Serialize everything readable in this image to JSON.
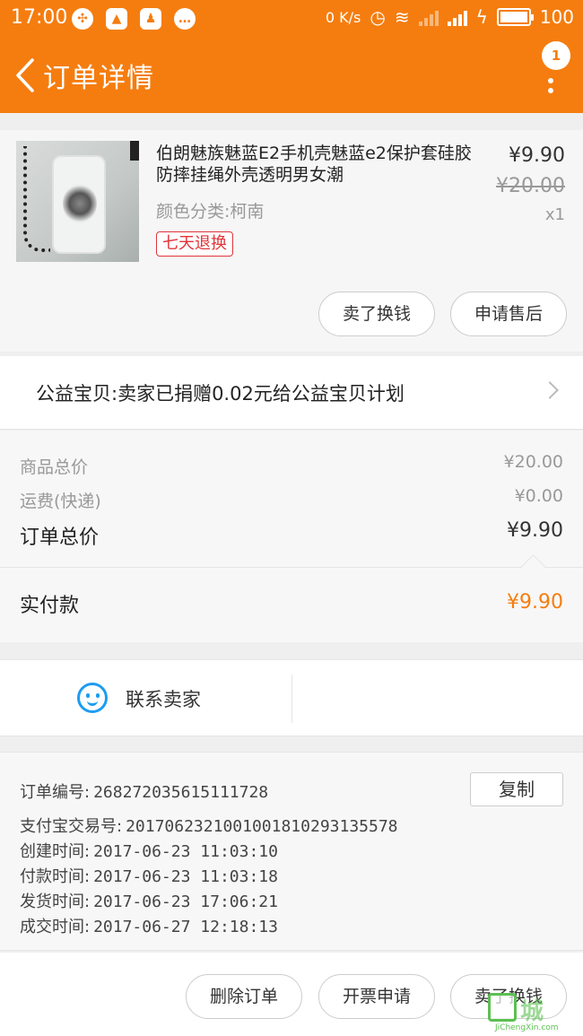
{
  "status_bar": {
    "time": "17:00",
    "net_speed": "0 K/s",
    "battery": "100"
  },
  "nav": {
    "title": "订单详情",
    "badge_count": "1"
  },
  "product": {
    "title": "伯朗魅族魅蓝E2手机壳魅蓝e2保护套硅胶防摔挂绳外壳透明男女潮",
    "price": "¥9.90",
    "original_price": "¥20.00",
    "quantity": "x1",
    "spec": "颜色分类:柯南",
    "badge": "七天退换",
    "buttons": {
      "sell": "卖了换钱",
      "after_sale": "申请售后"
    }
  },
  "charity": {
    "text": "公益宝贝:卖家已捐赠0.02元给公益宝贝计划"
  },
  "summary": {
    "goods_label": "商品总价",
    "goods_value": "¥20.00",
    "shipping_label": "运费(快递)",
    "shipping_value": "¥0.00",
    "total_label": "订单总价",
    "total_value": "¥9.90",
    "paid_label": "实付款",
    "paid_value": "¥9.90"
  },
  "contact": {
    "label": "联系卖家"
  },
  "order_info": {
    "order_no_label": "订单编号:",
    "order_no": "268272035615111728",
    "copy_label": "复制",
    "alipay_label": "支付宝交易号:",
    "alipay_no": "2017062321001001810293135578",
    "created_label": "创建时间:",
    "created": "2017-06-23 11:03:10",
    "paid_label": "付款时间:",
    "paid": "2017-06-23 11:03:18",
    "shipped_label": "发货时间:",
    "shipped": "2017-06-23 17:06:21",
    "done_label": "成交时间:",
    "done": "2017-06-27 12:18:13"
  },
  "actions": {
    "delete": "删除订单",
    "invoice": "开票申请",
    "sell": "卖了换钱"
  },
  "watermark": {
    "text": "城",
    "sub": "JiChengXin.com"
  },
  "colors": {
    "brand": "#f57d0f",
    "accent_red": "#e0353a",
    "contact_blue": "#1e9cf1"
  }
}
